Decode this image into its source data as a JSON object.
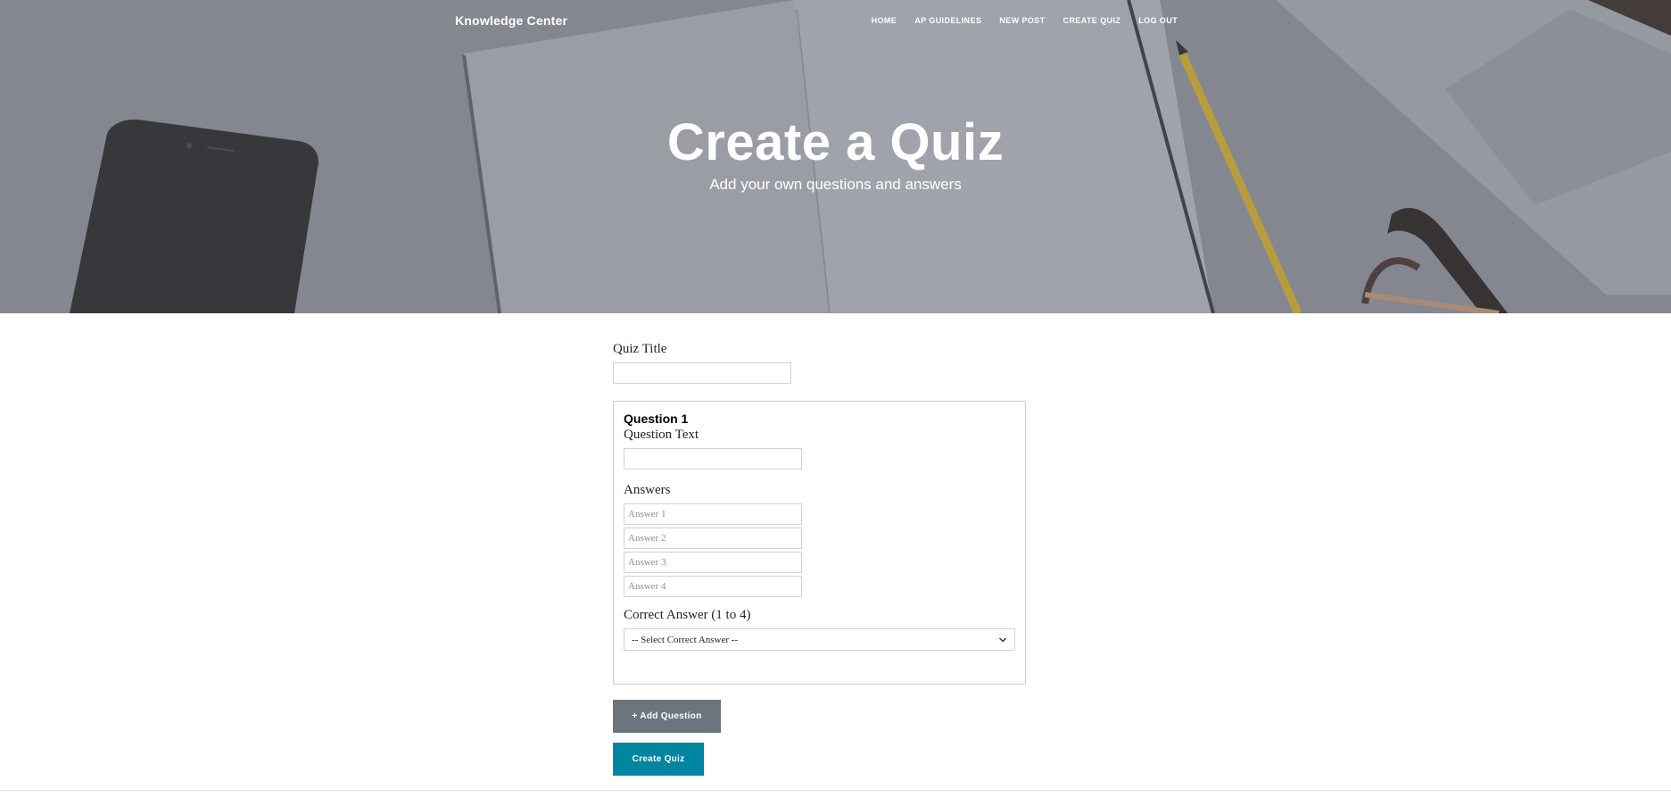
{
  "navbar": {
    "brand": "Knowledge Center",
    "links": [
      {
        "label": "HOME"
      },
      {
        "label": "AP GUIDELINES"
      },
      {
        "label": "NEW POST"
      },
      {
        "label": "CREATE QUIZ"
      },
      {
        "label": "LOG OUT"
      }
    ]
  },
  "hero": {
    "title": "Create a Quiz",
    "subtitle": "Add your own questions and answers"
  },
  "form": {
    "quiz_title_label": "Quiz Title",
    "quiz_title_value": "",
    "question": {
      "heading": "Question 1",
      "text_label": "Question Text",
      "text_value": "",
      "answers_label": "Answers",
      "answers": [
        {
          "placeholder": "Answer 1",
          "value": ""
        },
        {
          "placeholder": "Answer 2",
          "value": ""
        },
        {
          "placeholder": "Answer 3",
          "value": ""
        },
        {
          "placeholder": "Answer 4",
          "value": ""
        }
      ],
      "correct_label": "Correct Answer (1 to 4)",
      "correct_selected": "-- Select Correct Answer --"
    },
    "add_question_label": "+ Add Question",
    "create_quiz_label": "Create Quiz"
  },
  "colors": {
    "add_button": "#6c757d",
    "create_button": "#0085a1",
    "hero_overlay": "#868e96"
  }
}
